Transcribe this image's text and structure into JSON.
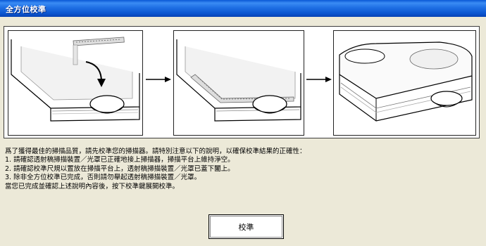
{
  "window": {
    "title": "全方位校準"
  },
  "illustration": {
    "steps": [
      {
        "icon": "scanner-placing-ruler-icon"
      },
      {
        "icon": "scanner-ruler-placed-icon"
      },
      {
        "icon": "scanner-lid-closed-icon"
      }
    ],
    "arrow_icon": "right-arrow-icon"
  },
  "instructions": {
    "intro": "爲了獲得最佳的掃描品質，請先校準您的掃描器。請特別注意以下的說明，以確保校準結果的正確性：",
    "item1": "1. 請確認透射稿掃描裝置／光罩已正確地接上掃描器，掃描平台上維持淨空。",
    "item2": "2. 請確認校準尺規以置放在掃描平台上，透射稿掃描裝置／光罩已蓋下闔上。",
    "item3": "3. 除非全方位校準已完成，否則請勿舉起透射稿掃描裝置／光罩。",
    "outro": "當您已完成並確認上述說明內容後，按下校準鍵展開校準。"
  },
  "buttons": {
    "calibrate_label": "校準"
  }
}
